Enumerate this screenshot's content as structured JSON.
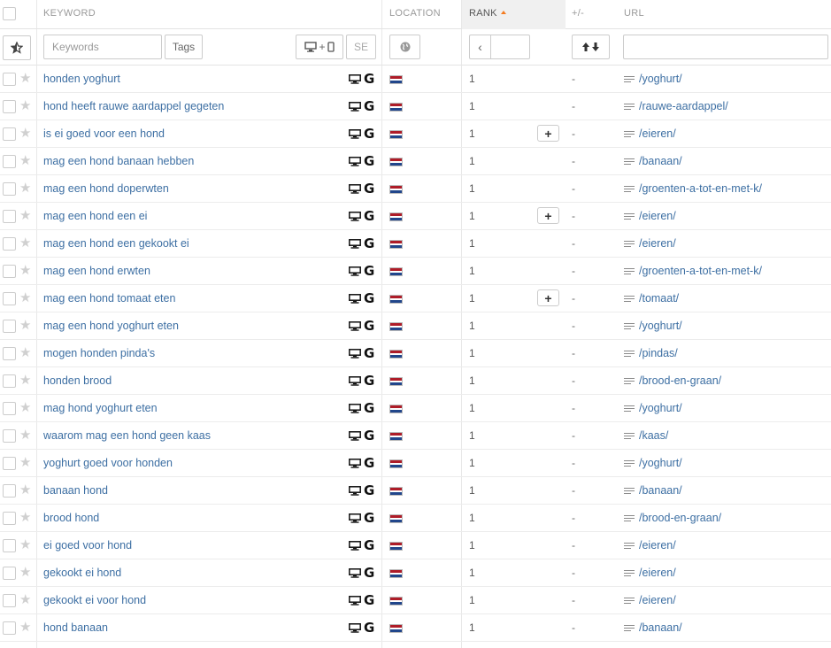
{
  "header": {
    "keyword": "KEYWORD",
    "location": "LOCATION",
    "rank": "RANK",
    "diff": "+/-",
    "url": "URL"
  },
  "filters": {
    "keywords_placeholder": "Keywords",
    "tags_label": "Tags",
    "device_label": "+",
    "se_label": "SE",
    "rank_prev": "‹",
    "url_value": ""
  },
  "colors": {
    "link": "#3d6fa3",
    "sort_accent": "#f47b20",
    "flag_red": "#ae1c28",
    "flag_white": "#ffffff",
    "flag_blue": "#21468b"
  },
  "rows": [
    {
      "keyword": "honden yoghurt",
      "rank": "1",
      "diff": "-",
      "url": "/yoghurt/",
      "plus": false
    },
    {
      "keyword": "hond heeft rauwe aardappel gegeten",
      "rank": "1",
      "diff": "-",
      "url": "/rauwe-aardappel/",
      "plus": false
    },
    {
      "keyword": "is ei goed voor een hond",
      "rank": "1",
      "diff": "-",
      "url": "/eieren/",
      "plus": true
    },
    {
      "keyword": "mag een hond banaan hebben",
      "rank": "1",
      "diff": "-",
      "url": "/banaan/",
      "plus": false
    },
    {
      "keyword": "mag een hond doperwten",
      "rank": "1",
      "diff": "-",
      "url": "/groenten-a-tot-en-met-k/",
      "plus": false
    },
    {
      "keyword": "mag een hond een ei",
      "rank": "1",
      "diff": "-",
      "url": "/eieren/",
      "plus": true
    },
    {
      "keyword": "mag een hond een gekookt ei",
      "rank": "1",
      "diff": "-",
      "url": "/eieren/",
      "plus": false
    },
    {
      "keyword": "mag een hond erwten",
      "rank": "1",
      "diff": "-",
      "url": "/groenten-a-tot-en-met-k/",
      "plus": false
    },
    {
      "keyword": "mag een hond tomaat eten",
      "rank": "1",
      "diff": "-",
      "url": "/tomaat/",
      "plus": true
    },
    {
      "keyword": "mag een hond yoghurt eten",
      "rank": "1",
      "diff": "-",
      "url": "/yoghurt/",
      "plus": false
    },
    {
      "keyword": "mogen honden pinda's",
      "rank": "1",
      "diff": "-",
      "url": "/pindas/",
      "plus": false
    },
    {
      "keyword": "honden brood",
      "rank": "1",
      "diff": "-",
      "url": "/brood-en-graan/",
      "plus": false
    },
    {
      "keyword": "mag hond yoghurt eten",
      "rank": "1",
      "diff": "-",
      "url": "/yoghurt/",
      "plus": false
    },
    {
      "keyword": "waarom mag een hond geen kaas",
      "rank": "1",
      "diff": "-",
      "url": "/kaas/",
      "plus": false
    },
    {
      "keyword": "yoghurt goed voor honden",
      "rank": "1",
      "diff": "-",
      "url": "/yoghurt/",
      "plus": false
    },
    {
      "keyword": "banaan hond",
      "rank": "1",
      "diff": "-",
      "url": "/banaan/",
      "plus": false
    },
    {
      "keyword": "brood hond",
      "rank": "1",
      "diff": "-",
      "url": "/brood-en-graan/",
      "plus": false
    },
    {
      "keyword": "ei goed voor hond",
      "rank": "1",
      "diff": "-",
      "url": "/eieren/",
      "plus": false
    },
    {
      "keyword": "gekookt ei hond",
      "rank": "1",
      "diff": "-",
      "url": "/eieren/",
      "plus": false
    },
    {
      "keyword": "gekookt ei voor hond",
      "rank": "1",
      "diff": "-",
      "url": "/eieren/",
      "plus": false
    },
    {
      "keyword": "hond banaan",
      "rank": "1",
      "diff": "-",
      "url": "/banaan/",
      "plus": false
    }
  ]
}
